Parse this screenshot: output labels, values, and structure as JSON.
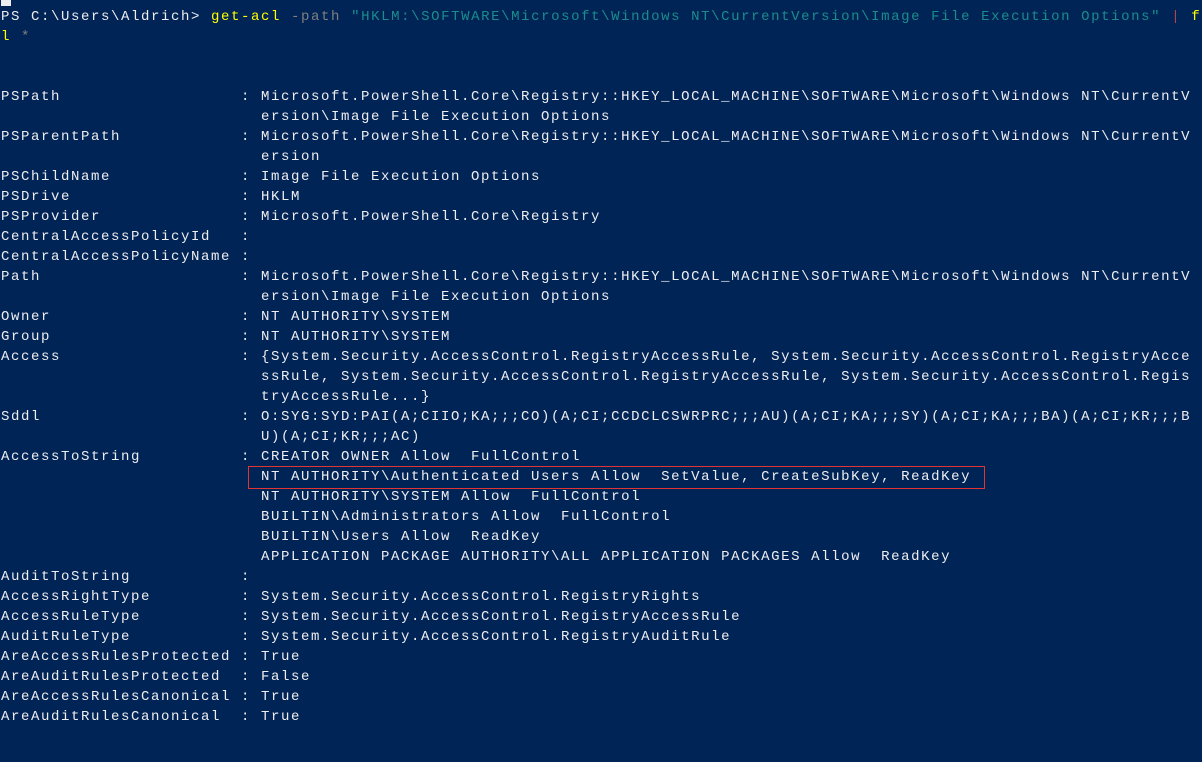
{
  "colors": {
    "background": "#012456",
    "text": "#eeedf0",
    "command": "#ffff00",
    "parameter": "#808080",
    "string": "#1b8c8c",
    "highlight_box": "#e03535"
  },
  "prompt": {
    "text": "PS C:\\Users\\Aldrich> ",
    "command": "get-acl",
    "parameter": " -path ",
    "argument": "\"HKLM:\\SOFTWARE\\Microsoft\\Windows NT\\CurrentVersion\\Image File Execution Options\"",
    "pipe": " | ",
    "pipe_cmd_a": "f",
    "pipe_cmd_b": "l",
    "wildcard": " *"
  },
  "properties": [
    {
      "name": "PSPath",
      "values": [
        "Microsoft.PowerShell.Core\\Registry::HKEY_LOCAL_MACHINE\\SOFTWARE\\Microsoft\\Windows NT\\CurrentV",
        "ersion\\Image File Execution Options"
      ]
    },
    {
      "name": "PSParentPath",
      "values": [
        "Microsoft.PowerShell.Core\\Registry::HKEY_LOCAL_MACHINE\\SOFTWARE\\Microsoft\\Windows NT\\CurrentV",
        "ersion"
      ]
    },
    {
      "name": "PSChildName",
      "values": [
        "Image File Execution Options"
      ]
    },
    {
      "name": "PSDrive",
      "values": [
        "HKLM"
      ]
    },
    {
      "name": "PSProvider",
      "values": [
        "Microsoft.PowerShell.Core\\Registry"
      ]
    },
    {
      "name": "CentralAccessPolicyId",
      "values": [
        ""
      ]
    },
    {
      "name": "CentralAccessPolicyName",
      "values": [
        ""
      ]
    },
    {
      "name": "Path",
      "values": [
        "Microsoft.PowerShell.Core\\Registry::HKEY_LOCAL_MACHINE\\SOFTWARE\\Microsoft\\Windows NT\\CurrentV",
        "ersion\\Image File Execution Options"
      ]
    },
    {
      "name": "Owner",
      "values": [
        "NT AUTHORITY\\SYSTEM"
      ]
    },
    {
      "name": "Group",
      "values": [
        "NT AUTHORITY\\SYSTEM"
      ]
    },
    {
      "name": "Access",
      "values": [
        "{System.Security.AccessControl.RegistryAccessRule, System.Security.AccessControl.RegistryAcce",
        "ssRule, System.Security.AccessControl.RegistryAccessRule, System.Security.AccessControl.Regis",
        "tryAccessRule...}"
      ]
    },
    {
      "name": "Sddl",
      "values": [
        "O:SYG:SYD:PAI(A;CIIO;KA;;;CO)(A;CI;CCDCLCSWRPRC;;;AU)(A;CI;KA;;;SY)(A;CI;KA;;;BA)(A;CI;KR;;;B",
        "U)(A;CI;KR;;;AC)"
      ]
    },
    {
      "name": "AccessToString",
      "values": [
        "CREATOR OWNER Allow  FullControl",
        "NT AUTHORITY\\Authenticated Users Allow  SetValue, CreateSubKey, ReadKey",
        "NT AUTHORITY\\SYSTEM Allow  FullControl",
        "BUILTIN\\Administrators Allow  FullControl",
        "BUILTIN\\Users Allow  ReadKey",
        "APPLICATION PACKAGE AUTHORITY\\ALL APPLICATION PACKAGES Allow  ReadKey"
      ]
    },
    {
      "name": "AuditToString",
      "values": [
        ""
      ]
    },
    {
      "name": "AccessRightType",
      "values": [
        "System.Security.AccessControl.RegistryRights"
      ]
    },
    {
      "name": "AccessRuleType",
      "values": [
        "System.Security.AccessControl.RegistryAccessRule"
      ]
    },
    {
      "name": "AuditRuleType",
      "values": [
        "System.Security.AccessControl.RegistryAuditRule"
      ]
    },
    {
      "name": "AreAccessRulesProtected",
      "values": [
        "True"
      ]
    },
    {
      "name": "AreAuditRulesProtected",
      "values": [
        "False"
      ]
    },
    {
      "name": "AreAccessRulesCanonical",
      "values": [
        "True"
      ]
    },
    {
      "name": "AreAuditRulesCanonical",
      "values": [
        "True"
      ]
    }
  ]
}
